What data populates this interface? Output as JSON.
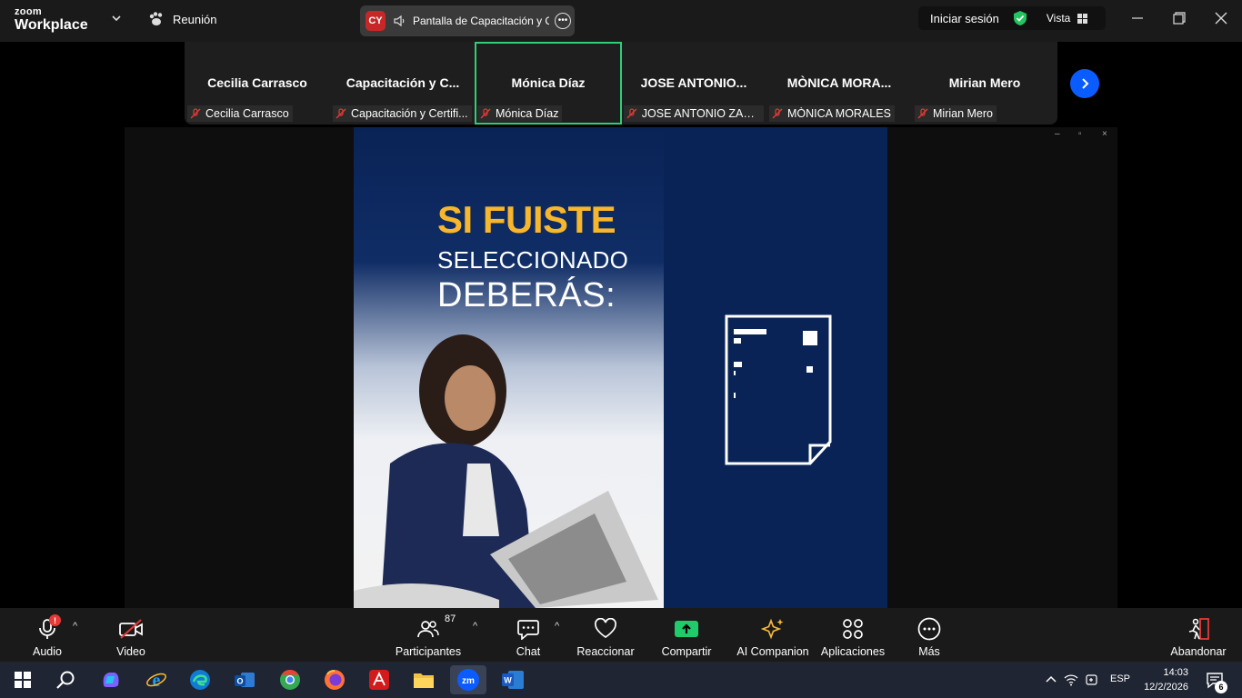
{
  "app": {
    "logo_top": "zoom",
    "logo_bottom": "Workplace"
  },
  "meeting": {
    "label": "Reunión"
  },
  "share": {
    "initials": "CY",
    "title": "Pantalla de Capacitación y C"
  },
  "account": {
    "signin": "Iniciar sesión",
    "view": "Vista"
  },
  "participants": [
    {
      "name": "Cecilia Carrasco",
      "label": "Cecilia Carrasco",
      "active": false
    },
    {
      "name": "Capacitación  y  C...",
      "label": "Capacitación y Certifi...",
      "active": false
    },
    {
      "name": "Mónica Díaz",
      "label": "Mónica Díaz",
      "active": true
    },
    {
      "name": "JOSE  ANTONIO...",
      "label": "JOSE ANTONIO ZAM...",
      "active": false
    },
    {
      "name": "MÒNICA  MORA...",
      "label": "MÒNICA MORALES",
      "active": false
    },
    {
      "name": "Mirian Mero",
      "label": "Mirian Mero",
      "active": false
    }
  ],
  "slide": {
    "line1": "SI FUISTE",
    "line2": "SELECCIONADO",
    "line3": "DEBERÁS:"
  },
  "toolbar": {
    "audio": "Audio",
    "audio_badge": "!",
    "video": "Video",
    "participants": "Participantes",
    "participants_count": "87",
    "chat": "Chat",
    "react": "Reaccionar",
    "share": "Compartir",
    "ai": "AI Companion",
    "apps": "Aplicaciones",
    "more": "Más",
    "leave": "Abandonar"
  },
  "taskbar": {
    "lang": "ESP",
    "time": "14:03",
    "date": "12/2/2026",
    "notif_count": "6"
  },
  "colors": {
    "accent": "#0b5cff",
    "active_border": "#2fce79",
    "share_green": "#1fcb6b",
    "slide_bg": "#0a2356",
    "slide_title": "#f7b62b"
  }
}
